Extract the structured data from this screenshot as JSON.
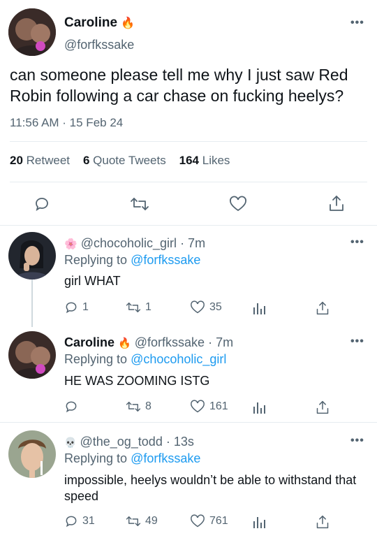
{
  "main_tweet": {
    "display_name": "Caroline",
    "emoji": "🔥",
    "handle": "@forfkssake",
    "text": "can someone please tell me why I just saw Red Robin following a car chase on fucking heelys?",
    "timestamp": "11:56 AM · 15 Feb 24",
    "stats": {
      "retweets_count": "20",
      "retweets_label": "Retweet",
      "quotes_count": "6",
      "quotes_label": "Quote Tweets",
      "likes_count": "164",
      "likes_label": "Likes"
    }
  },
  "replies": [
    {
      "emoji": "🌸",
      "handle": "@chocoholic_girl",
      "time": "· 7m",
      "replying_label": "Replying to",
      "replying_to": "@forfkssake",
      "text": "girl WHAT",
      "reply_count": "1",
      "retweet_count": "1",
      "like_count": "35"
    },
    {
      "display_name": "Caroline",
      "emoji": "🔥",
      "handle": "@forfkssake",
      "time": "· 7m",
      "replying_label": "Replying to",
      "replying_to": "@chocoholic_girl",
      "text": "HE WAS ZOOMING ISTG",
      "reply_count": "",
      "retweet_count": "8",
      "like_count": "161"
    },
    {
      "emoji": "💀",
      "handle": "@the_og_todd",
      "time": "· 13s",
      "replying_label": "Replying to",
      "replying_to": "@forfkssake",
      "text": "impossible, heelys wouldn’t be able to withstand that speed",
      "reply_count": "31",
      "retweet_count": "49",
      "like_count": "761"
    }
  ],
  "more_glyph": "•••",
  "colors": {
    "link": "#1d9bf0",
    "secondary": "#536471",
    "divider": "#e6ecf0"
  }
}
